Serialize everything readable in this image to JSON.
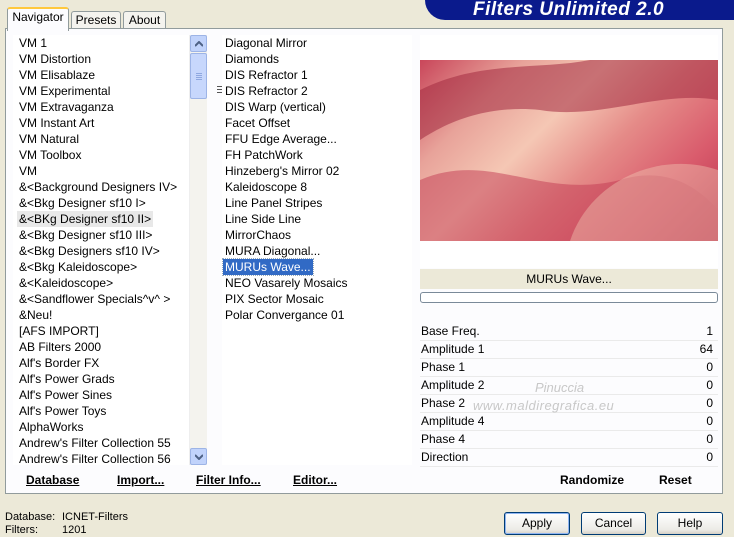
{
  "banner": {
    "title": "Filters Unlimited 2.0"
  },
  "tabs": [
    {
      "label": "Navigator",
      "active": true
    },
    {
      "label": "Presets"
    },
    {
      "label": "About"
    }
  ],
  "categories": [
    "VM 1",
    "VM Distortion",
    "VM Elisablaze",
    "VM Experimental",
    "VM Extravaganza",
    "VM Instant Art",
    "VM Natural",
    "VM Toolbox",
    "VM",
    "&<Background Designers IV>",
    "&<Bkg Designer sf10 I>",
    "&<BKg Designer sf10 II>",
    "&<Bkg Designer sf10 III>",
    "&<Bkg Designers sf10 IV>",
    "&<Bkg Kaleidoscope>",
    "&<Kaleidoscope>",
    "&<Sandflower Specials^v^ >",
    "&Neu!",
    "[AFS IMPORT]",
    "AB Filters 2000",
    "Alf's Border FX",
    "Alf's Power Grads",
    "Alf's Power Sines",
    "Alf's Power Toys",
    "AlphaWorks",
    "Andrew's Filter Collection 55",
    "Andrew's Filter Collection 56"
  ],
  "filters": [
    "Diagonal Mirror",
    "Diamonds",
    "DIS Refractor 1",
    "DIS Refractor 2",
    "DIS Warp (vertical)",
    "Facet Offset",
    "FFU Edge Average...",
    "FH PatchWork",
    "Hinzeberg's Mirror 02",
    "Kaleidoscope 8",
    "Line Panel Stripes",
    "Line Side Line",
    "MirrorChaos",
    "MURA Diagonal...",
    "MURUs Wave...",
    "NEO Vasarely Mosaics",
    "PIX Sector Mosaic",
    "Polar Convergance 01"
  ],
  "panel_buttons": {
    "database": "Database",
    "import": "Import...",
    "filter_info": "Filter Info...",
    "editor": "Editor..."
  },
  "preview": {
    "filter_name": "MURUs Wave..."
  },
  "params": [
    {
      "label": "Base Freq.",
      "value": "1"
    },
    {
      "label": "Amplitude 1",
      "value": "64"
    },
    {
      "label": "Phase 1",
      "value": "0"
    },
    {
      "label": "Amplitude 2",
      "value": "0"
    },
    {
      "label": "Phase 2",
      "value": "0"
    },
    {
      "label": "Amplitude 4",
      "value": "0"
    },
    {
      "label": "Phase 4",
      "value": "0"
    },
    {
      "label": "Direction",
      "value": "0"
    }
  ],
  "actions": {
    "randomize": "Randomize",
    "reset": "Reset"
  },
  "footer": {
    "database_label": "Database:",
    "database_value": "ICNET-Filters",
    "filters_label": "Filters:",
    "filters_value": "1201"
  },
  "dialog_buttons": {
    "apply": "Apply",
    "cancel": "Cancel",
    "help": "Help"
  },
  "watermark": {
    "line1": "Pinuccia",
    "line2": "www.maldiregrafica.eu"
  }
}
